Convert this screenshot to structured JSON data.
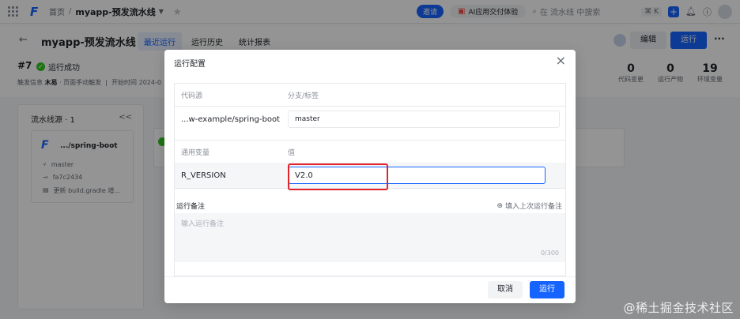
{
  "topnav": {
    "breadcrumb_home": "首页",
    "breadcrumb_current": "myapp-预发流水线",
    "invite_label": "邀请",
    "ai_label": "AI应用交付体验",
    "search_placeholder": "在 流水线 中搜索",
    "shortcut": "⌘ K"
  },
  "header": {
    "title": "myapp-预发流水线",
    "tabs": [
      {
        "label": "最近运行"
      },
      {
        "label": "运行历史"
      },
      {
        "label": "统计报表"
      }
    ],
    "edit_label": "编辑",
    "run_label": "运行",
    "run_number": "#7",
    "run_status": "运行成功",
    "trigger_prefix": "触发信息",
    "trigger_user": "木易",
    "trigger_text": "· 页面手动触发",
    "start_prefix": "开始时间",
    "start_time": "2024-0",
    "stats": [
      {
        "value": "0",
        "label": "代码变更"
      },
      {
        "value": "0",
        "label": "运行产物"
      },
      {
        "value": "19",
        "label": "环境变量"
      }
    ]
  },
  "source_panel": {
    "title": "流水线源 · 1",
    "card": {
      "name": ".../spring-boot",
      "branch": "master",
      "commit": "fa7c2434",
      "message": "更新 build.gradle 增..."
    }
  },
  "dialog": {
    "title": "运行配置",
    "source_header": "代码源",
    "branch_header": "分支/标签",
    "source_repo": "...w-example/spring-boot",
    "branch_value": "master",
    "var_header": "通用变量",
    "value_header": "值",
    "var_name": "R_VERSION",
    "var_value": "V2.0",
    "notes_label": "运行备注",
    "notes_fill": "填入上次运行备注",
    "notes_placeholder": "输入运行备注",
    "notes_counter": "0/300",
    "cancel_label": "取消",
    "run_label": "运行"
  },
  "watermark": "@稀土掘金技术社区",
  "colors": {
    "primary": "#1664ff",
    "success": "#34c724",
    "highlight": "#e0242b"
  }
}
